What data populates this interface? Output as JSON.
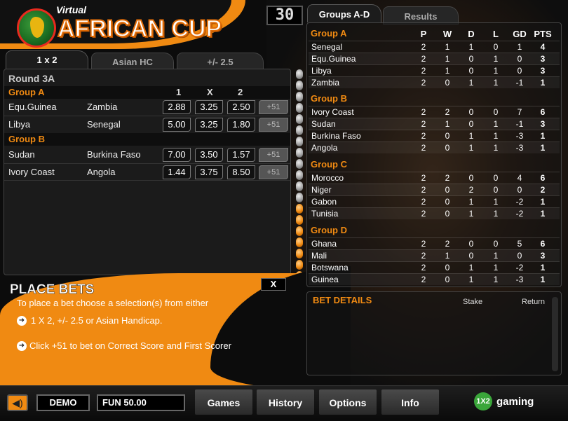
{
  "logo": {
    "virtual": "Virtual",
    "title": "AFRICAN CUP"
  },
  "timer": "30",
  "left_tabs": [
    "1 x 2",
    "Asian HC",
    "+/- 2.5"
  ],
  "round": "Round 3A",
  "odds_headers": [
    "1",
    "X",
    "2"
  ],
  "matches": [
    {
      "group": "Group A",
      "rows": [
        {
          "home": "Equ.Guinea",
          "away": "Zambia",
          "o1": "2.88",
          "ox": "3.25",
          "o2": "2.50",
          "more": "+51"
        },
        {
          "home": "Libya",
          "away": "Senegal",
          "o1": "5.00",
          "ox": "3.25",
          "o2": "1.80",
          "more": "+51"
        }
      ]
    },
    {
      "group": "Group B",
      "rows": [
        {
          "home": "Sudan",
          "away": "Burkina Faso",
          "o1": "7.00",
          "ox": "3.50",
          "o2": "1.57",
          "more": "+51"
        },
        {
          "home": "Ivory Coast",
          "away": "Angola",
          "o1": "1.44",
          "ox": "3.75",
          "o2": "8.50",
          "more": "+51"
        }
      ]
    }
  ],
  "close_label": "X",
  "place_bets": {
    "title": "PLACE BETS",
    "line1": "To place a bet choose a selection(s) from either",
    "line2": "1 X 2, +/- 2.5 or Asian Handicap.",
    "line3": "Click +51 to bet on Correct Score and First Scorer"
  },
  "right_tabs": [
    "Groups A-D",
    "Results"
  ],
  "table_headers": [
    "P",
    "W",
    "D",
    "L",
    "GD",
    "PTS"
  ],
  "groups": [
    {
      "name": "Group A",
      "teams": [
        [
          "Senegal",
          "2",
          "1",
          "1",
          "0",
          "1",
          "4"
        ],
        [
          "Equ.Guinea",
          "2",
          "1",
          "0",
          "1",
          "0",
          "3"
        ],
        [
          "Libya",
          "2",
          "1",
          "0",
          "1",
          "0",
          "3"
        ],
        [
          "Zambia",
          "2",
          "0",
          "1",
          "1",
          "-1",
          "1"
        ]
      ]
    },
    {
      "name": "Group B",
      "teams": [
        [
          "Ivory Coast",
          "2",
          "2",
          "0",
          "0",
          "7",
          "6"
        ],
        [
          "Sudan",
          "2",
          "1",
          "0",
          "1",
          "-1",
          "3"
        ],
        [
          "Burkina Faso",
          "2",
          "0",
          "1",
          "1",
          "-3",
          "1"
        ],
        [
          "Angola",
          "2",
          "0",
          "1",
          "1",
          "-3",
          "1"
        ]
      ]
    },
    {
      "name": "Group C",
      "teams": [
        [
          "Morocco",
          "2",
          "2",
          "0",
          "0",
          "4",
          "6"
        ],
        [
          "Niger",
          "2",
          "0",
          "2",
          "0",
          "0",
          "2"
        ],
        [
          "Gabon",
          "2",
          "0",
          "1",
          "1",
          "-2",
          "1"
        ],
        [
          "Tunisia",
          "2",
          "0",
          "1",
          "1",
          "-2",
          "1"
        ]
      ]
    },
    {
      "name": "Group D",
      "teams": [
        [
          "Ghana",
          "2",
          "2",
          "0",
          "0",
          "5",
          "6"
        ],
        [
          "Mali",
          "2",
          "1",
          "0",
          "1",
          "0",
          "3"
        ],
        [
          "Botswana",
          "2",
          "0",
          "1",
          "1",
          "-2",
          "1"
        ],
        [
          "Guinea",
          "2",
          "0",
          "1",
          "1",
          "-3",
          "1"
        ]
      ]
    }
  ],
  "bet_details": {
    "title": "BET DETAILS",
    "stake": "Stake",
    "return": "Return"
  },
  "bottom": {
    "demo": "DEMO",
    "fun": "FUN 50.00",
    "nav": [
      "Games",
      "History",
      "Options",
      "Info"
    ],
    "brand_mark": "1X2",
    "brand": "gaming"
  },
  "colors": {
    "accent": "#f08a12",
    "background": "#0c0c0c"
  }
}
